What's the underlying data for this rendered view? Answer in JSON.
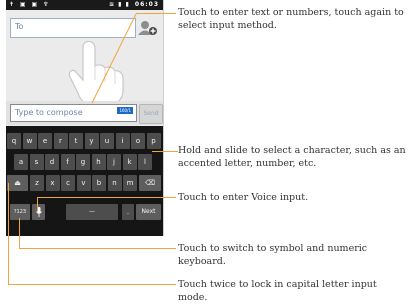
{
  "status_bar": {
    "time": "06:03"
  },
  "recipient": {
    "placeholder": "To"
  },
  "composer": {
    "placeholder": "Type to compose",
    "counter": "160/1",
    "send_label": "Send"
  },
  "keyboard": {
    "row1": [
      "q",
      "w",
      "e",
      "r",
      "t",
      "y",
      "u",
      "i",
      "o",
      "p"
    ],
    "row2": [
      "a",
      "s",
      "d",
      "f",
      "g",
      "h",
      "j",
      "k",
      "l"
    ],
    "row3": [
      "z",
      "x",
      "c",
      "v",
      "b",
      "n",
      "m"
    ],
    "symbol_label": "?123",
    "space_label": "—",
    "period_label": ".",
    "next_label": "Next"
  },
  "callouts": {
    "input": "Touch to enter text or numbers, touch again to select input method.",
    "hold_slide": "Hold and slide to select a character, such as an accented letter, number, etc.",
    "voice": "Touch to enter Voice input.",
    "symbol": "Touch to switch to symbol and numeric keyboard.",
    "caps_lock": "Touch twice to lock in capital letter input mode."
  },
  "colors": {
    "accent": "#f2a33b",
    "keyboard_bg": "#151515",
    "key": "#4d4d4d",
    "field_text": "#6f87a4"
  }
}
